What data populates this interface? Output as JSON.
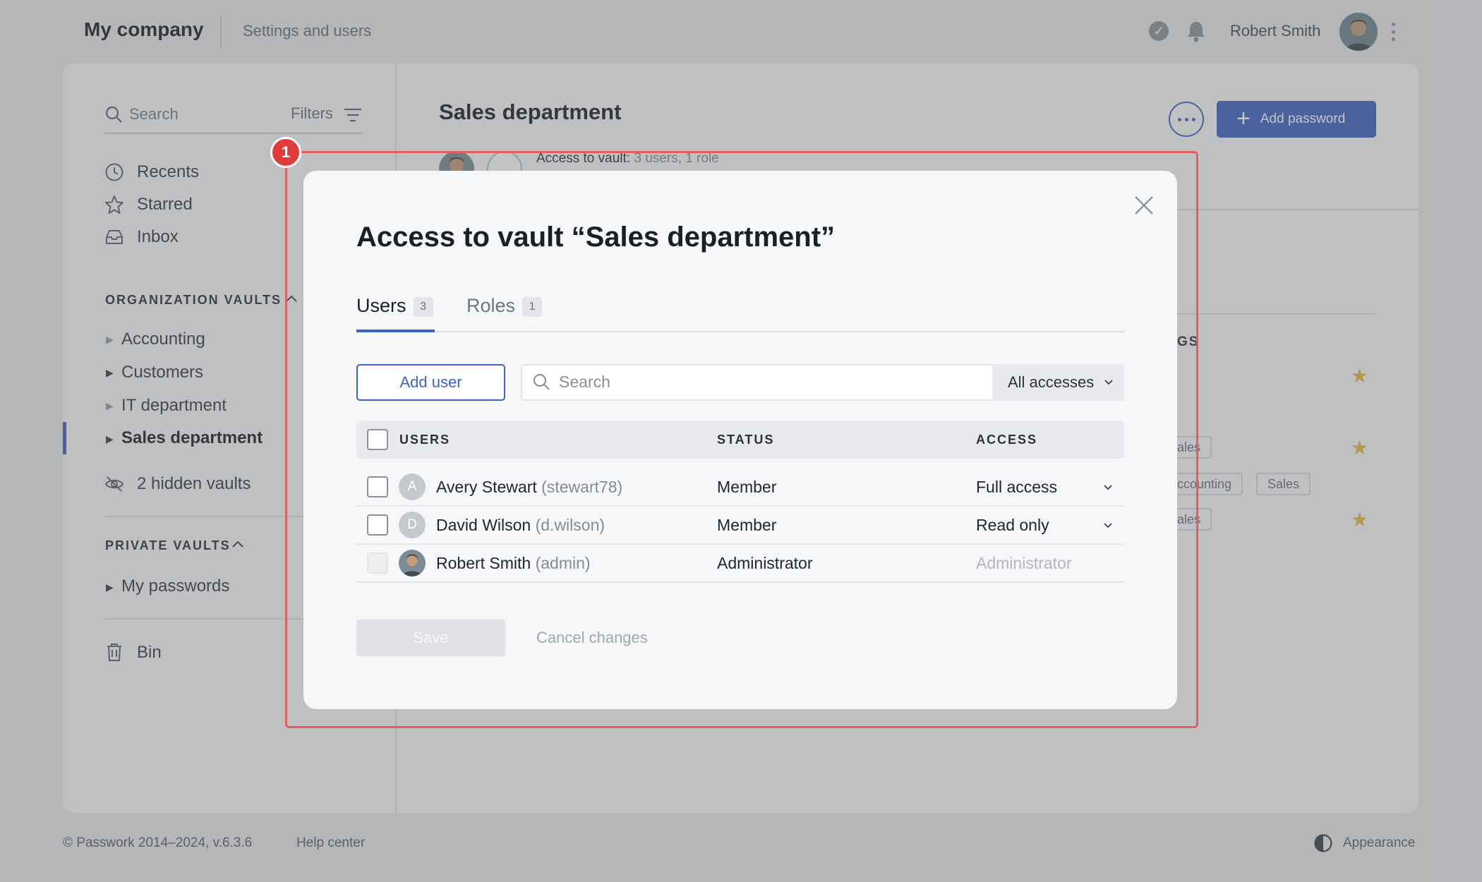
{
  "topbar": {
    "brand": "My company",
    "subtitle": "Settings and users",
    "user_name": "Robert Smith"
  },
  "sidebar": {
    "search_placeholder": "Search",
    "filters_label": "Filters",
    "nav": [
      {
        "label": "Recents",
        "icon": "clock-icon"
      },
      {
        "label": "Starred",
        "icon": "star-icon"
      },
      {
        "label": "Inbox",
        "icon": "inbox-icon"
      }
    ],
    "org_section": "ORGANIZATION VAULTS",
    "org_vaults": [
      {
        "label": "Accounting"
      },
      {
        "label": "Customers"
      },
      {
        "label": "IT department"
      },
      {
        "label": "Sales department",
        "active": true
      }
    ],
    "hidden_vaults": "2 hidden vaults",
    "private_section": "PRIVATE VAULTS",
    "private_vaults": [
      {
        "label": "My passwords"
      }
    ],
    "bin": "Bin"
  },
  "content": {
    "title": "Sales department",
    "add_password": "Add password",
    "access_label": "Access to vault:",
    "access_value": "3 users, 1 role",
    "tags_heading": "GS",
    "tags": [
      "ales",
      "ccounting",
      "Sales",
      "ales"
    ]
  },
  "highlight": {
    "number": "1"
  },
  "modal": {
    "title": "Access to vault “Sales department”",
    "tabs": [
      {
        "label": "Users",
        "count": "3",
        "active": true
      },
      {
        "label": "Roles",
        "count": "1",
        "active": false
      }
    ],
    "add_user": "Add user",
    "search_placeholder": "Search",
    "access_filter": "All accesses",
    "columns": {
      "users": "USERS",
      "status": "STATUS",
      "access": "ACCESS"
    },
    "rows": [
      {
        "initial": "A",
        "name": "Avery Stewart",
        "login": "(stewart78)",
        "status": "Member",
        "access": "Full access",
        "editable": true
      },
      {
        "initial": "D",
        "name": "David Wilson",
        "login": "(d.wilson)",
        "status": "Member",
        "access": "Read only",
        "editable": true
      },
      {
        "initial": "",
        "name": "Robert Smith",
        "login": "(admin)",
        "status": "Administrator",
        "access": "Administrator",
        "editable": false
      }
    ],
    "save": "Save",
    "cancel": "Cancel changes"
  },
  "footer": {
    "copyright": "© Passwork 2014–2024, v.6.3.6",
    "help": "Help center",
    "appearance": "Appearance"
  },
  "colors": {
    "accent": "#3d63c4",
    "highlight": "#e0605f",
    "star": "#e7b93e"
  }
}
